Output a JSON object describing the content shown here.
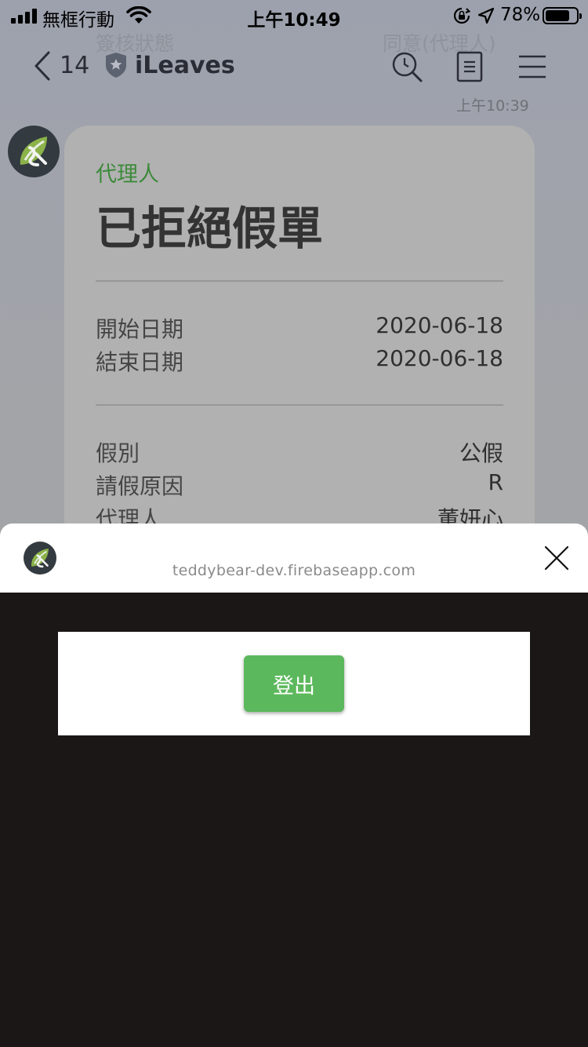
{
  "status_bar": {
    "carrier": "無框行動",
    "time": "上午10:49",
    "battery_percent": "78%",
    "battery_level": 0.78
  },
  "background_chat": {
    "ghost_left": "簽核狀態",
    "ghost_right": "同意(代理人)",
    "nav": {
      "back_count": "14",
      "title": "iLeaves"
    },
    "message_time": "上午10:39",
    "card": {
      "role": "代理人",
      "title": "已拒絕假單",
      "dates": [
        {
          "label": "開始日期",
          "value": "2020-06-18"
        },
        {
          "label": "結束日期",
          "value": "2020-06-18"
        }
      ],
      "details": [
        {
          "label": "假別",
          "value": "公假"
        },
        {
          "label": "請假原因",
          "value": "R"
        },
        {
          "label": "代理人",
          "value": "董妍心"
        }
      ]
    }
  },
  "webview": {
    "domain": "teddybear-dev.firebaseapp.com",
    "logout_label": "登出",
    "accent_color": "#5cb85c"
  },
  "icons": [
    "signal-icon",
    "wifi-icon",
    "orientation-lock-icon",
    "location-arrow-icon",
    "battery-icon",
    "back-chevron-icon",
    "shield-badge-icon",
    "search-icon",
    "notes-icon",
    "menu-icon",
    "app-logo-icon",
    "close-icon"
  ]
}
